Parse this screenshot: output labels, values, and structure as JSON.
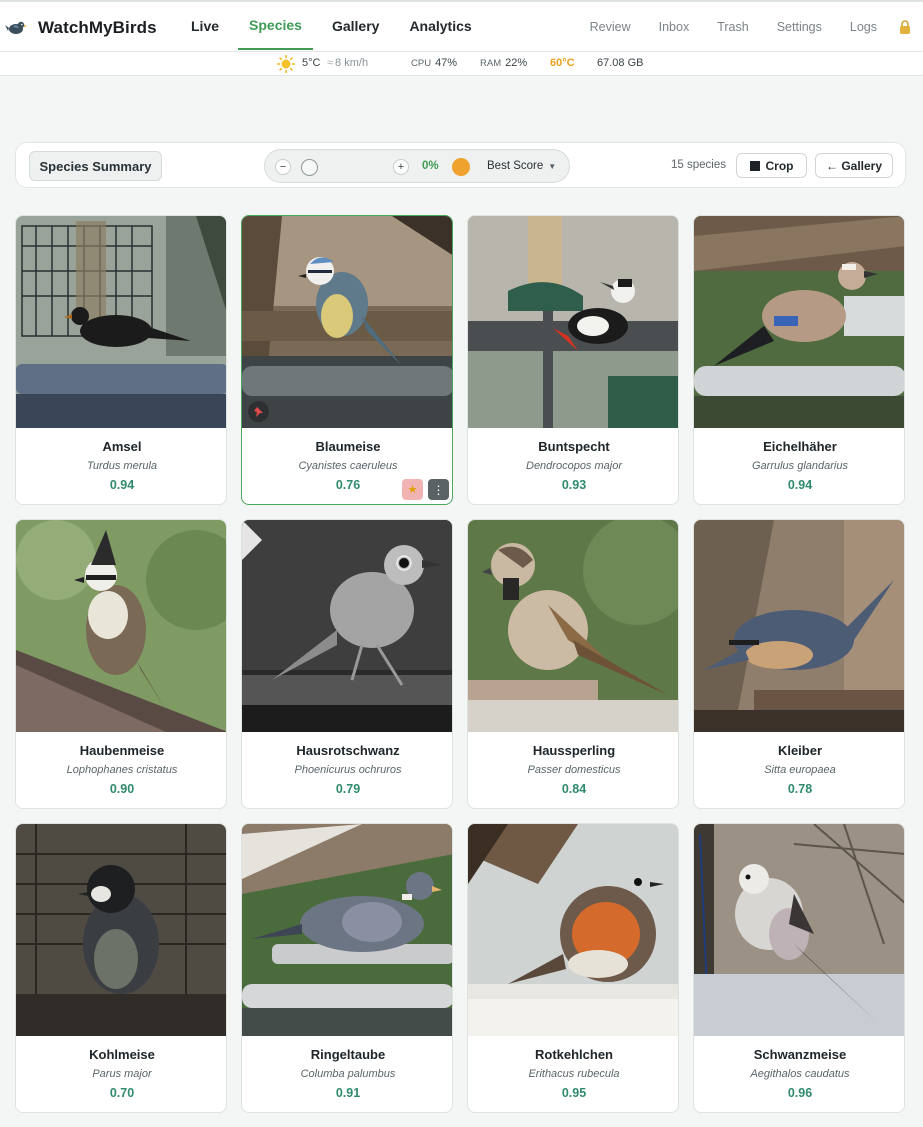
{
  "app": {
    "name": "WatchMyBirds"
  },
  "nav": {
    "main": [
      {
        "label": "Live",
        "active": false
      },
      {
        "label": "Species",
        "active": true
      },
      {
        "label": "Gallery",
        "active": false
      },
      {
        "label": "Analytics",
        "active": false
      }
    ],
    "secondary": [
      "Review",
      "Inbox",
      "Trash",
      "Settings",
      "Logs"
    ]
  },
  "status": {
    "temp": "5°C",
    "wind": "8 km/h",
    "cpu_label": "CPU",
    "cpu": "47%",
    "ram_label": "RAM",
    "ram": "22%",
    "cpu_temp": "60°C",
    "disk": "67.08 GB"
  },
  "toolbar": {
    "summary_label": "Species Summary",
    "zoom_minus": "−",
    "zoom_plus": "+",
    "zoom_value": "0%",
    "sort_label": "Best Score",
    "count": "15 species",
    "crop_label": "Crop",
    "gallery_label": "← Gallery"
  },
  "species": [
    {
      "name": "Amsel",
      "latin": "Turdus merula",
      "score": "0.94"
    },
    {
      "name": "Blaumeise",
      "latin": "Cyanistes caeruleus",
      "score": "0.76",
      "selected": true
    },
    {
      "name": "Buntspecht",
      "latin": "Dendrocopos major",
      "score": "0.93"
    },
    {
      "name": "Eichelhäher",
      "latin": "Garrulus glandarius",
      "score": "0.94"
    },
    {
      "name": "Haubenmeise",
      "latin": "Lophophanes cristatus",
      "score": "0.90"
    },
    {
      "name": "Hausrotschwanz",
      "latin": "Phoenicurus ochruros",
      "score": "0.79"
    },
    {
      "name": "Haussperling",
      "latin": "Passer domesticus",
      "score": "0.84"
    },
    {
      "name": "Kleiber",
      "latin": "Sitta europaea",
      "score": "0.78"
    },
    {
      "name": "Kohlmeise",
      "latin": "Parus major",
      "score": "0.70"
    },
    {
      "name": "Ringeltaube",
      "latin": "Columba palumbus",
      "score": "0.91"
    },
    {
      "name": "Rotkehlchen",
      "latin": "Erithacus rubecula",
      "score": "0.95"
    },
    {
      "name": "Schwanzmeise",
      "latin": "Aegithalos caudatus",
      "score": "0.96"
    }
  ],
  "colors": {
    "accent": "#3f9b55",
    "score": "#2f8a6e",
    "warning": "#e8a21d"
  }
}
